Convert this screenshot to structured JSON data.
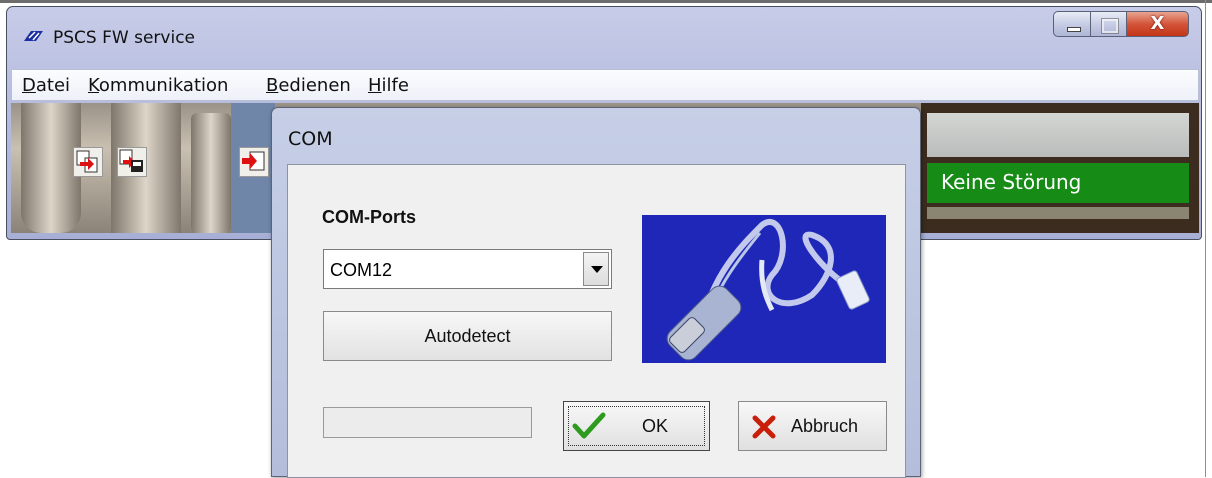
{
  "window": {
    "title": "PSCS FW service",
    "buttons": {
      "minimize": "minimize",
      "maximize": "maximize",
      "close": "X"
    }
  },
  "menubar": {
    "items": [
      {
        "pre": "",
        "key": "D",
        "post": "atei"
      },
      {
        "pre": "",
        "key": "K",
        "post": "ommunikation"
      },
      {
        "pre": "",
        "key": "B",
        "post": "edienen"
      },
      {
        "pre": "",
        "key": "H",
        "post": "ilfe"
      }
    ]
  },
  "toolbar": {
    "icons": [
      "copy-red-icon",
      "save-icon",
      "import-icon"
    ]
  },
  "status": {
    "text": "Keine Störung",
    "color": "#168c16"
  },
  "dialog": {
    "title": "COM",
    "ports_label": "COM-Ports",
    "selected_port": "COM12",
    "autodetect_label": "Autodetect",
    "ok_label": "OK",
    "cancel_label": "Abbruch",
    "image": "usb-serial-adapter-image"
  },
  "colors": {
    "accent_blue": "#1f27b8",
    "ok_check": "#2e9b1e",
    "cancel_x": "#c81e0a"
  }
}
